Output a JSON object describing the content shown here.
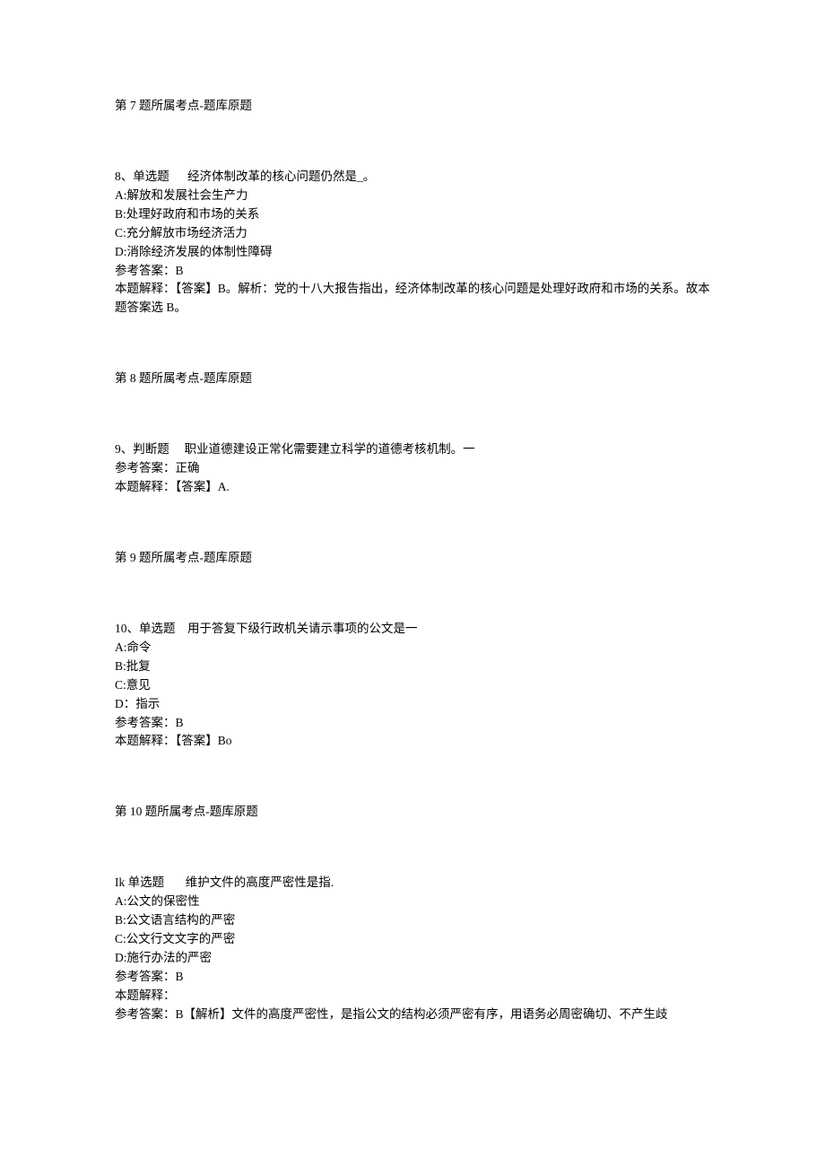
{
  "q7": {
    "source": "第 7 题所属考点-题库原题"
  },
  "q8": {
    "header_num": "8、单选题",
    "header_text": "经济体制改革的核心问题仍然是_。",
    "A": "A:解放和发展社会生产力",
    "B": "B:处理好政府和市场的关系",
    "C": "C:充分解放市场经济活力",
    "D": "D:消除经济发展的体制性障碍",
    "ans": "参考答案：B",
    "exp": "本题解释：【答案】B。解析：党的十八大报告指出，经济体制改革的核心问题是处理好政府和市场的关系。故本题答案选 B。",
    "source": "第 8 题所属考点-题库原题"
  },
  "q9": {
    "header_num": "9、判断题",
    "header_text": "职业道德建设正常化需要建立科学的道德考核机制。一",
    "ans": "参考答案：正确",
    "exp": "本题解释：【答案】A.",
    "source": "第 9 题所属考点-题库原题"
  },
  "q10": {
    "header_num": "10、单选题",
    "header_text": "用于答复下级行政机关请示事项的公文是一",
    "A": "A:命令",
    "B": "B:批复",
    "C": "C:意见",
    "D": "D：指示",
    "ans": "参考答案：B",
    "exp": "本题解释：【答案】Bo",
    "source": "第 10 题所属考点-题库原题"
  },
  "q11": {
    "header_num": "Ik 单选题",
    "header_text": "维护文件的高度严密性是指.",
    "A": "A:公文的保密性",
    "B": "B:公文语言结构的严密",
    "C": "C:公文行文文字的严密",
    "D": "D:施行办法的严密",
    "ans": "参考答案：B",
    "exp1": "本题解释：",
    "exp2": "参考答案：B【解析】文件的高度严密性，是指公文的结构必须严密有序，用语务必周密确切、不产生歧"
  }
}
